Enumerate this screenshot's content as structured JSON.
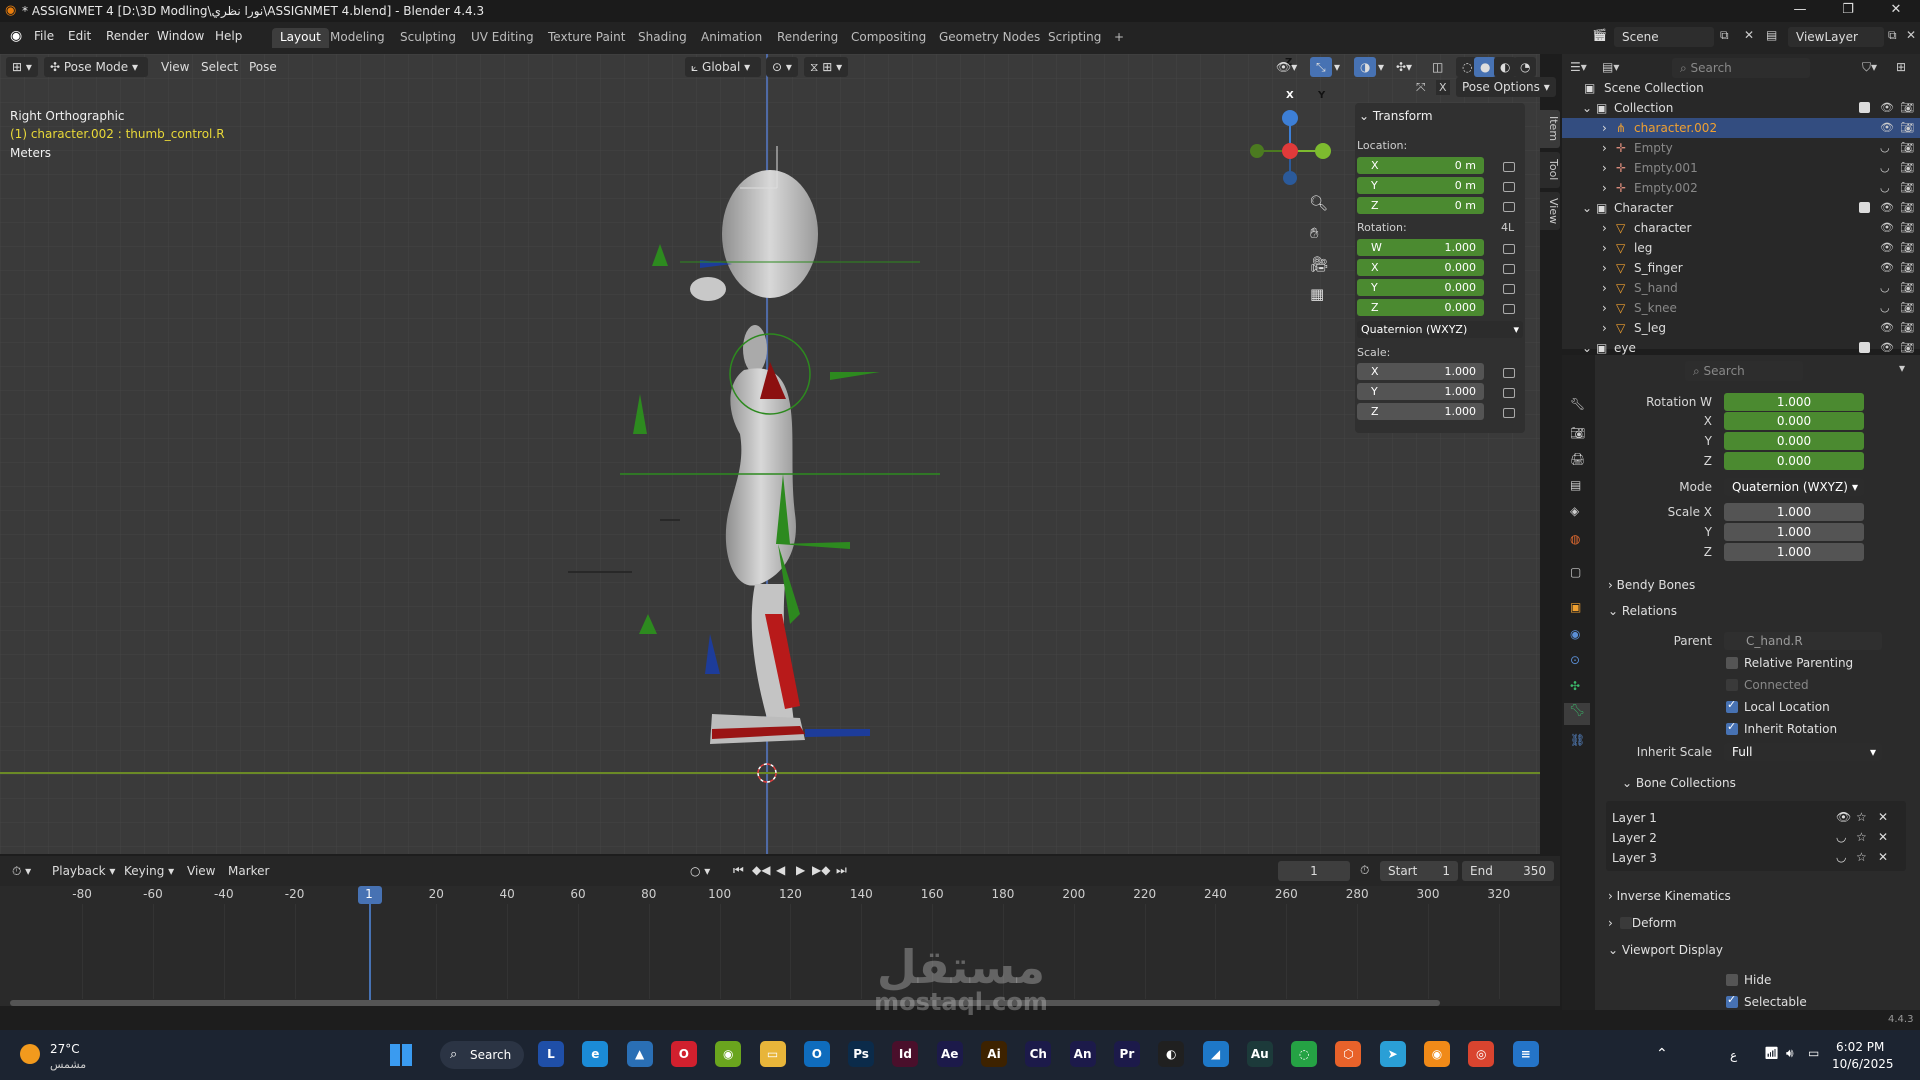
{
  "window": {
    "title": "* ASSIGNMET 4 [D:\\3D Modling\\نورا نظري\\ASSIGNMET 4.blend] - Blender 4.4.3",
    "min": "—",
    "max": "❐",
    "close": "✕"
  },
  "menu": {
    "items": [
      "File",
      "Edit",
      "Render",
      "Window",
      "Help"
    ],
    "workspaces": [
      "Layout",
      "Modeling",
      "Sculpting",
      "UV Editing",
      "Texture Paint",
      "Shading",
      "Animation",
      "Rendering",
      "Compositing",
      "Geometry Nodes",
      "Scripting"
    ],
    "add_tab": "+",
    "scene_label": "Scene",
    "viewlayer_label": "ViewLayer"
  },
  "viewport_header": {
    "mode": "Pose Mode",
    "view": "View",
    "select": "Select",
    "pose": "Pose",
    "orientation": "Global",
    "pose_options": "Pose Options"
  },
  "viewport_overlay": {
    "view_name": "Right Orthographic",
    "active": "(1) character.002 : thumb_control.R",
    "units": "Meters",
    "gizmo_x": "X",
    "gizmo_y": "Y",
    "gizmo_z": "Z"
  },
  "npanel": {
    "title": "Transform",
    "location_label": "Location:",
    "location": [
      {
        "k": "X",
        "v": "0 m"
      },
      {
        "k": "Y",
        "v": "0 m"
      },
      {
        "k": "Z",
        "v": "0 m"
      }
    ],
    "rotation_label": "Rotation:",
    "rotation_extra": "4L",
    "rotation": [
      {
        "k": "W",
        "v": "1.000"
      },
      {
        "k": "X",
        "v": "0.000"
      },
      {
        "k": "Y",
        "v": "0.000"
      },
      {
        "k": "Z",
        "v": "0.000"
      }
    ],
    "rotation_mode": "Quaternion (WXYZ)",
    "scale_label": "Scale:",
    "scale": [
      {
        "k": "X",
        "v": "1.000"
      },
      {
        "k": "Y",
        "v": "1.000"
      },
      {
        "k": "Z",
        "v": "1.000"
      }
    ],
    "tabs": [
      "Item",
      "Tool",
      "View"
    ]
  },
  "timeline": {
    "menus": [
      "Playback",
      "Keying",
      "View",
      "Marker"
    ],
    "current_frame": "1",
    "start_label": "Start",
    "start": "1",
    "end_label": "End",
    "end": "350",
    "ticks": [
      "-80",
      "-60",
      "-40",
      "-20",
      "1",
      "20",
      "40",
      "60",
      "80",
      "100",
      "120",
      "140",
      "160",
      "180",
      "200",
      "220",
      "240",
      "260",
      "280",
      "300",
      "320"
    ]
  },
  "outliner": {
    "search_placeholder": "Search",
    "scene_collection": "Scene Collection",
    "rows": [
      {
        "label": "Collection",
        "level": 0,
        "kind": "collection"
      },
      {
        "label": "character.002",
        "level": 1,
        "kind": "armature",
        "selected": true
      },
      {
        "label": "Empty",
        "level": 1,
        "kind": "empty",
        "dim": true
      },
      {
        "label": "Empty.001",
        "level": 1,
        "kind": "empty",
        "dim": true
      },
      {
        "label": "Empty.002",
        "level": 1,
        "kind": "empty",
        "dim": true
      },
      {
        "label": "Character",
        "level": 0,
        "kind": "collection"
      },
      {
        "label": "character",
        "level": 1,
        "kind": "mesh"
      },
      {
        "label": "leg",
        "level": 1,
        "kind": "mesh"
      },
      {
        "label": "S_finger",
        "level": 1,
        "kind": "mesh"
      },
      {
        "label": "S_hand",
        "level": 1,
        "kind": "mesh",
        "dim": true
      },
      {
        "label": "S_knee",
        "level": 1,
        "kind": "mesh",
        "dim": true
      },
      {
        "label": "S_leg",
        "level": 1,
        "kind": "mesh"
      },
      {
        "label": "eye",
        "level": 0,
        "kind": "collection"
      }
    ]
  },
  "properties": {
    "search_placeholder": "Search",
    "rotation_w_label": "Rotation W",
    "rotation_w": "1.000",
    "rot_x_label": "X",
    "rot_x": "0.000",
    "rot_y_label": "Y",
    "rot_y": "0.000",
    "rot_z_label": "Z",
    "rot_z": "0.000",
    "mode_label": "Mode",
    "mode": "Quaternion (WXYZ)",
    "scale_x_label": "Scale X",
    "scale_x": "1.000",
    "scale_y_label": "Y",
    "scale_y": "1.000",
    "scale_z_label": "Z",
    "scale_z": "1.000",
    "bendy_bones": "Bendy Bones",
    "relations": "Relations",
    "parent_label": "Parent",
    "parent": "C_hand.R",
    "relative_parenting": "Relative Parenting",
    "connected": "Connected",
    "local_location": "Local Location",
    "inherit_rotation": "Inherit Rotation",
    "inherit_scale_label": "Inherit Scale",
    "inherit_scale": "Full",
    "bone_collections": "Bone Collections",
    "layers": [
      "Layer 1",
      "Layer 2",
      "Layer 3"
    ],
    "inverse_kinematics": "Inverse Kinematics",
    "deform": "Deform",
    "viewport_display": "Viewport Display",
    "hide": "Hide",
    "selectable": "Selectable",
    "version": "4.4.3"
  },
  "taskbar": {
    "weather_temp": "27°C",
    "weather_desc": "مشمس",
    "search": "Search",
    "lang": "ع",
    "time": "6:02 PM",
    "date": "10/6/2025",
    "watermark": "mostaql.com",
    "watermark_ar": "مستقل"
  },
  "colors": {
    "accent_green": "#4b8a30",
    "selection_blue": "#4772b3",
    "active_orange": "#f0a030"
  }
}
